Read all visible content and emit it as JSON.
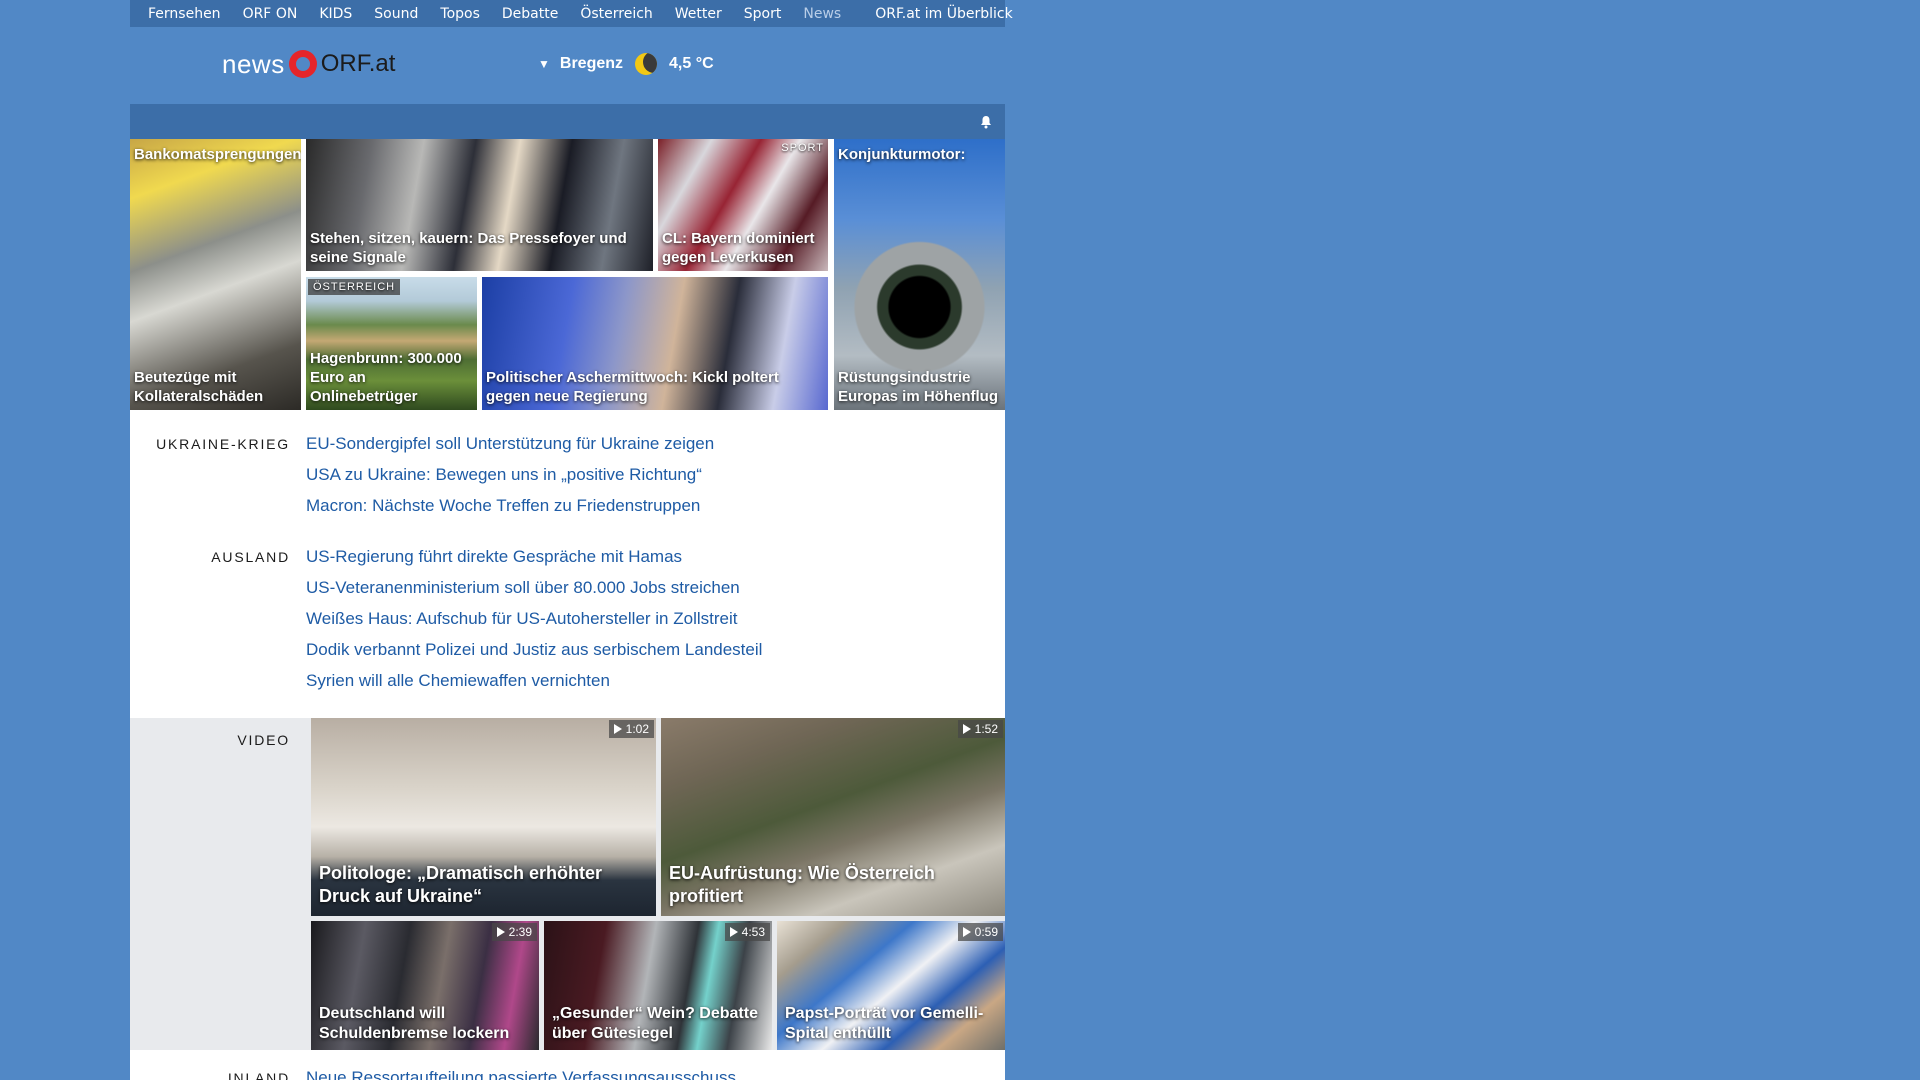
{
  "nav": {
    "items": [
      "Fernsehen",
      "ORF ON",
      "KIDS",
      "Sound",
      "Topos",
      "Debatte",
      "Österreich",
      "Wetter",
      "Sport",
      "News"
    ],
    "active": "News",
    "overview": "ORF.at im Überblick"
  },
  "logo": {
    "news": "news",
    "orf": "ORF.at"
  },
  "weather": {
    "location": "Bregenz",
    "temp": "4,5 °C",
    "icon": "moon-icon"
  },
  "tiles": {
    "atm": {
      "top": "Bankomatsprengungen:",
      "caption": "Beutezüge mit Kollateralschäden"
    },
    "press": {
      "caption": "Stehen, sitzen, kauern: Das Pressefoyer und seine Signale"
    },
    "bayern": {
      "tag": "SPORT",
      "caption": "CL: Bayern dominiert gegen Leverkusen"
    },
    "gun": {
      "top": "Konjunkturmotor:",
      "caption": "Rüstungsindustrie Europas im Höhenflug"
    },
    "town": {
      "tag": "ÖSTERREICH",
      "caption": "Hagenbrunn: 300.000 Euro an Onlinebetrüger"
    },
    "kickl": {
      "caption": "Politischer Aschermittwoch: Kickl poltert gegen neue Regierung"
    }
  },
  "sections": {
    "ukraine": {
      "label": "UKRAINE-KRIEG",
      "items": [
        "EU-Sondergipfel soll Unterstützung für Ukraine zeigen",
        "USA zu Ukraine: Bewegen uns in „positive Richtung“",
        "Macron: Nächste Woche Treffen zu Friedenstruppen"
      ]
    },
    "ausland": {
      "label": "AUSLAND",
      "items": [
        "US-Regierung führt direkte Gespräche mit Hamas",
        "US-Veteranenministerium soll über 80.000 Jobs streichen",
        "Weißes Haus: Aufschub für US-Autohersteller in Zollstreit",
        "Dodik verbannt Polizei und Justiz aus serbischem Landesteil",
        "Syrien will alle Chemiewaffen vernichten"
      ]
    },
    "inland": {
      "label": "INLAND",
      "items": [
        "Neue Ressortaufteilung passierte Verfassungsausschuss"
      ]
    }
  },
  "video": {
    "label": "VIDEO",
    "items": [
      {
        "caption": "Politologe: „Dramatisch erhöhter Druck auf Ukraine“",
        "duration": "1:02"
      },
      {
        "caption": "EU-Aufrüstung: Wie Österreich profitiert",
        "duration": "1:52"
      },
      {
        "caption": "Deutschland will Schuldenbremse lockern",
        "duration": "2:39"
      },
      {
        "caption": "„Gesunder“ Wein? Debatte über Gütesiegel",
        "duration": "4:53"
      },
      {
        "caption": "Papst-Porträt vor Gemelli-Spital enthüllt",
        "duration": "0:59"
      }
    ]
  },
  "colors": {
    "page_bg": "#5188c6",
    "nav_bg": "#3c6ea8",
    "link": "#1e5ba5",
    "logo_red": "#e5252a"
  }
}
